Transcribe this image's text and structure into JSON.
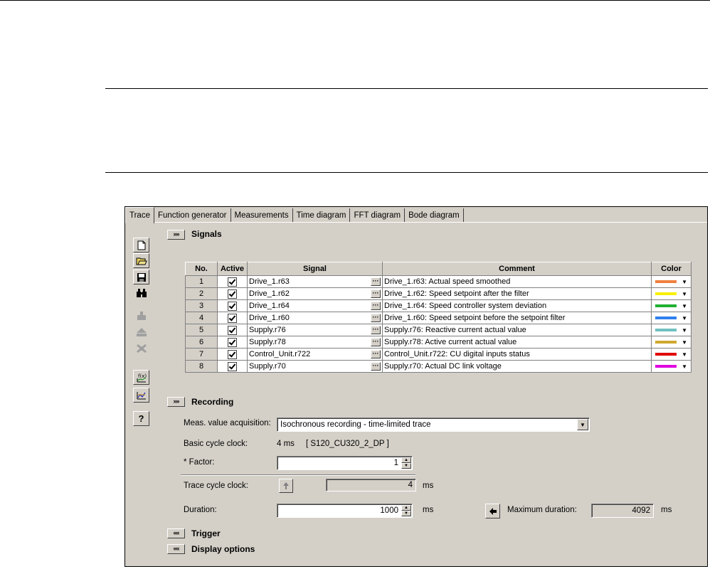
{
  "tabs": [
    "Trace",
    "Function generator",
    "Measurements",
    "Time diagram",
    "FFT diagram",
    "Bode diagram"
  ],
  "toolbar": {
    "icons": [
      "new-file-icon",
      "open-folder-icon",
      "save-disk-icon",
      "binoculars-icon",
      "upload-icon",
      "eject-icon",
      "disconnect-icon",
      "function-icon",
      "chart-icon",
      "help-icon"
    ],
    "help_label": "?"
  },
  "signals": {
    "toggle_label": "»»",
    "title": "Signals",
    "columns": {
      "no": "No.",
      "active": "Active",
      "signal": "Signal",
      "comment": "Comment",
      "color": "Color"
    },
    "rows": [
      {
        "no": "1",
        "signal": "Drive_1.r63",
        "comment": "Drive_1.r63: Actual speed smoothed",
        "color": "#f08040"
      },
      {
        "no": "2",
        "signal": "Drive_1.r62",
        "comment": "Drive_1.r62: Speed setpoint after the filter",
        "color": "#f8f000"
      },
      {
        "no": "3",
        "signal": "Drive_1.r64",
        "comment": "Drive_1.r64: Speed controller system deviation",
        "color": "#20b030"
      },
      {
        "no": "4",
        "signal": "Drive_1.r60",
        "comment": "Drive_1.r60: Speed setpoint before the setpoint filter",
        "color": "#3080f0"
      },
      {
        "no": "5",
        "signal": "Supply.r76",
        "comment": "Supply.r76: Reactive current actual value",
        "color": "#70c0c0"
      },
      {
        "no": "6",
        "signal": "Supply.r78",
        "comment": "Supply.r78: Active current actual value",
        "color": "#d0a830"
      },
      {
        "no": "7",
        "signal": "Control_Unit.r722",
        "comment": "Control_Unit.r722: CU digital inputs status",
        "color": "#e00000"
      },
      {
        "no": "8",
        "signal": "Supply.r70",
        "comment": "Supply.r70: Actual DC link voltage",
        "color": "#e000e0"
      }
    ]
  },
  "recording": {
    "toggle_label": "»»",
    "title": "Recording",
    "meas_label": "Meas. value acquisition:",
    "meas_value": "Isochronous recording - time-limited trace",
    "basic_cycle_label": "Basic cycle clock:",
    "basic_cycle_value": "4 ms",
    "basic_cycle_device": "[ S120_CU320_2_DP ]",
    "factor_label": "* Factor:",
    "factor_value": "1",
    "trace_cycle_label": "Trace cycle clock:",
    "trace_cycle_value": "4",
    "trace_cycle_unit": "ms",
    "duration_label": "Duration:",
    "duration_value": "1000",
    "duration_unit": "ms",
    "max_duration_label": "Maximum duration:",
    "max_duration_value": "4092",
    "max_duration_unit": "ms"
  },
  "trigger": {
    "toggle_label": "««",
    "title": "Trigger"
  },
  "display_options": {
    "toggle_label": "««",
    "title": "Display options"
  }
}
